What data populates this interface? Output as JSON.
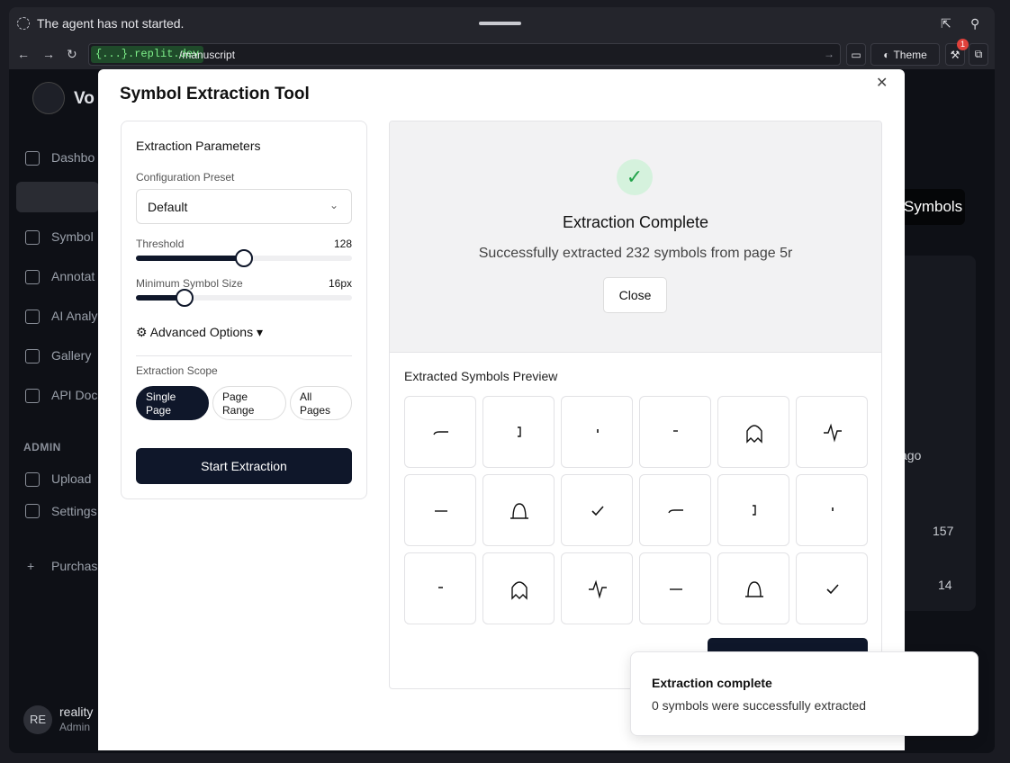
{
  "agent_bar": {
    "status": "The agent has not started."
  },
  "browser": {
    "domain": "{...}.replit.dev",
    "path": "/manuscript",
    "theme_label": "Theme",
    "notification_count": "1"
  },
  "sidebar": {
    "brand": "Vo",
    "items": [
      "Dashbo",
      "Symbol",
      "Annotat",
      "AI Analy",
      "Gallery",
      "API Doc"
    ],
    "admin_header": "ADMIN",
    "admin_items": [
      "Upload",
      "Settings"
    ],
    "purchase": "Purchas",
    "user_initials": "RE",
    "user_name": "reality",
    "user_role": "Admin"
  },
  "background": {
    "symbols_button": "Symbols",
    "ago": "ago",
    "count_a": "157",
    "count_b": "14"
  },
  "modal": {
    "title": "Symbol Extraction Tool",
    "params": {
      "title": "Extraction Parameters",
      "preset_label": "Configuration Preset",
      "preset_value": "Default",
      "threshold_label": "Threshold",
      "threshold_value": "128",
      "threshold_fraction": 0.5,
      "min_size_label": "Minimum Symbol Size",
      "min_size_value": "16px",
      "min_size_fraction": 0.225,
      "advanced_label": "Advanced Options ▾",
      "scope_label": "Extraction Scope",
      "scope_options": [
        "Single Page",
        "Page Range",
        "All Pages"
      ],
      "scope_selected": "Single Page",
      "start_button": "Start Extraction"
    },
    "result": {
      "title": "Extraction Complete",
      "subtitle": "Successfully extracted 232 symbols from page 5r",
      "close_button": "Close",
      "preview_title": "Extracted Symbols Preview",
      "symbols": [
        "underscore",
        "bracket",
        "tick-mark",
        "dash",
        "ghost-arch",
        "pulse",
        "dash-long",
        "bell-arch",
        "checkmark",
        "underscore",
        "bracket",
        "tick-mark",
        "dash",
        "ghost-arch",
        "pulse",
        "dash-long",
        "bell-arch",
        "checkmark"
      ]
    }
  },
  "toast": {
    "title": "Extraction complete",
    "message": "0 symbols were successfully extracted"
  }
}
